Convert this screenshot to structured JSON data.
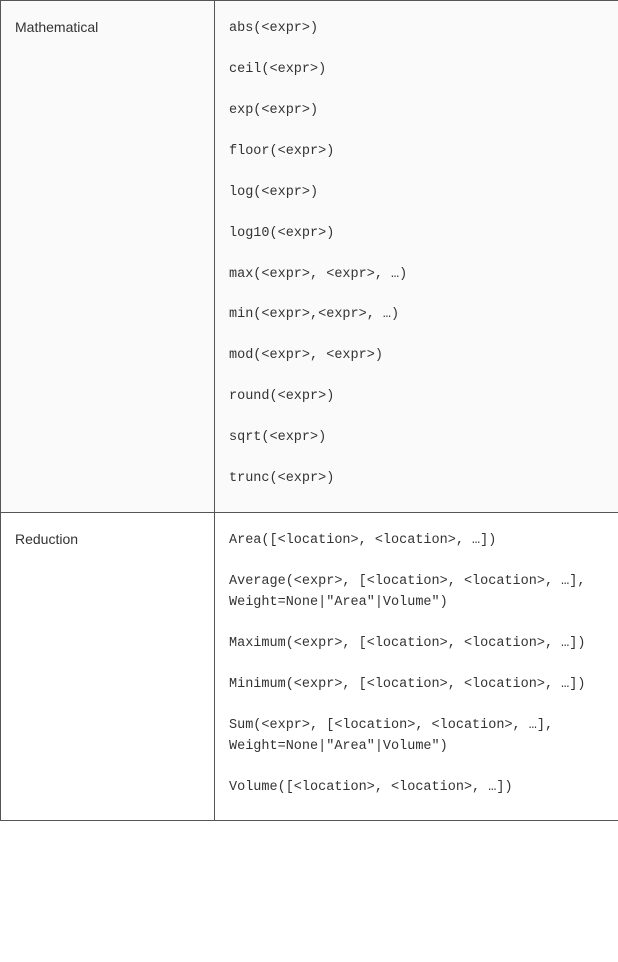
{
  "rows": [
    {
      "category": "Mathematical",
      "functions": [
        "abs(<expr>)",
        "ceil(<expr>)",
        "exp(<expr>)",
        "floor(<expr>)",
        "log(<expr>)",
        "log10(<expr>)",
        "max(<expr>, <expr>, …)",
        "min(<expr>,<expr>, …)",
        "mod(<expr>, <expr>)",
        "round(<expr>)",
        "sqrt(<expr>)",
        "trunc(<expr>)"
      ]
    },
    {
      "category": "Reduction",
      "functions": [
        "Area([<location>, <location>, …])",
        "Average(<expr>, [<location>, <location>, …], Weight=None|\"Area\"|Volume\")",
        "Maximum(<expr>, [<location>, <location>, …])",
        "Minimum(<expr>, [<location>, <location>, …])",
        "Sum(<expr>, [<location>, <location>, …], Weight=None|\"Area\"|Volume\")",
        "Volume([<location>, <location>, …])"
      ]
    }
  ]
}
